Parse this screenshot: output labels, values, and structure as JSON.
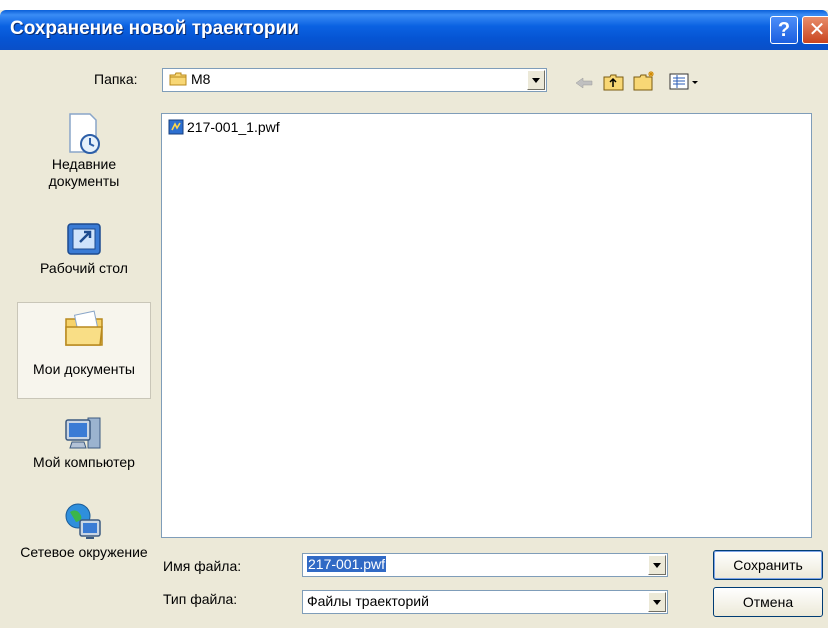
{
  "window": {
    "title": "Сохранение новой траектории",
    "help_glyph": "?",
    "close_glyph": "✕"
  },
  "folder": {
    "label": "Папка:",
    "current": "M8"
  },
  "places": [
    {
      "label": "Недавние документы",
      "icon": "recent-documents-icon"
    },
    {
      "label": "Рабочий стол",
      "icon": "desktop-icon"
    },
    {
      "label": "Мои документы",
      "icon": "my-documents-icon",
      "selected": true
    },
    {
      "label": "Мой компьютер",
      "icon": "my-computer-icon"
    },
    {
      "label": "Сетевое окружение",
      "icon": "network-icon"
    }
  ],
  "files": [
    {
      "name": "217-001_1.pwf",
      "icon": "pwf-file-icon"
    }
  ],
  "filename": {
    "label": "Имя файла:",
    "value": "217-001.pwf"
  },
  "filetype": {
    "label": "Тип файла:",
    "value": "Файлы траекторий"
  },
  "buttons": {
    "save": "Сохранить",
    "cancel": "Отмена"
  },
  "colors": {
    "titlebar": "#0a5fd8",
    "dialog_bg": "#ece9d8",
    "selection": "#316ac5"
  }
}
